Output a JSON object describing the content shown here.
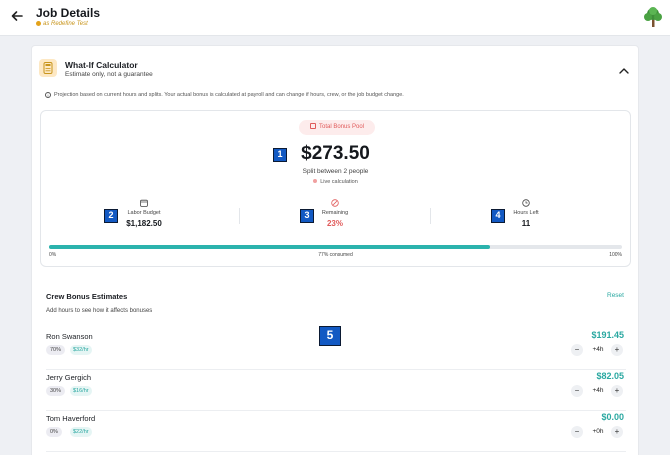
{
  "header": {
    "title": "Job Details",
    "subtitle": "as Redefine Test"
  },
  "calculator": {
    "title": "What-If Calculator",
    "subtitle": "Estimate only, not a guarantee",
    "note": "Projection based on current hours and splits. Your actual bonus is calculated at payroll and can change if hours, crew, or the job budget change.",
    "pool_label": "Total Bonus Pool",
    "amount": "$273.50",
    "split_text": "Split between 2 people",
    "live_text": "Live calculation",
    "badges": [
      "1",
      "2",
      "3",
      "4",
      "5"
    ],
    "stats": {
      "labor_budget": {
        "label": "Labor Budget",
        "value": "$1,182.50"
      },
      "remaining": {
        "label": "Remaining",
        "value": "23%"
      },
      "hours_left": {
        "label": "Hours Left",
        "value": "11"
      }
    },
    "progress": {
      "percent_consumed": 77,
      "start_label": "0%",
      "mid_label": "77% consumed",
      "end_label": "100%"
    }
  },
  "crew": {
    "title": "Crew Bonus Estimates",
    "reset_label": "Reset",
    "subtitle": "Add hours to see how it affects bonuses",
    "members": [
      {
        "name": "Ron Swanson",
        "percent": "70%",
        "rate": "$32/hr",
        "bonus": "$191.45",
        "hours": "+4h"
      },
      {
        "name": "Jerry Gergich",
        "percent": "30%",
        "rate": "$16/hr",
        "bonus": "$82.05",
        "hours": "+4h"
      },
      {
        "name": "Tom Haverford",
        "percent": "0%",
        "rate": "$22/hr",
        "bonus": "$0.00",
        "hours": "+0h"
      }
    ],
    "minus_symbol": "−",
    "plus_symbol": "+"
  },
  "colors": {
    "accent_teal": "#2aa8a1",
    "alert_red": "#e05a5a",
    "badge_blue": "#1259c3"
  },
  "icons": {
    "back": "arrow-left-icon",
    "avatar": "tree-icon",
    "calculator": "calculator-icon",
    "collapse": "chevron-up-icon"
  }
}
